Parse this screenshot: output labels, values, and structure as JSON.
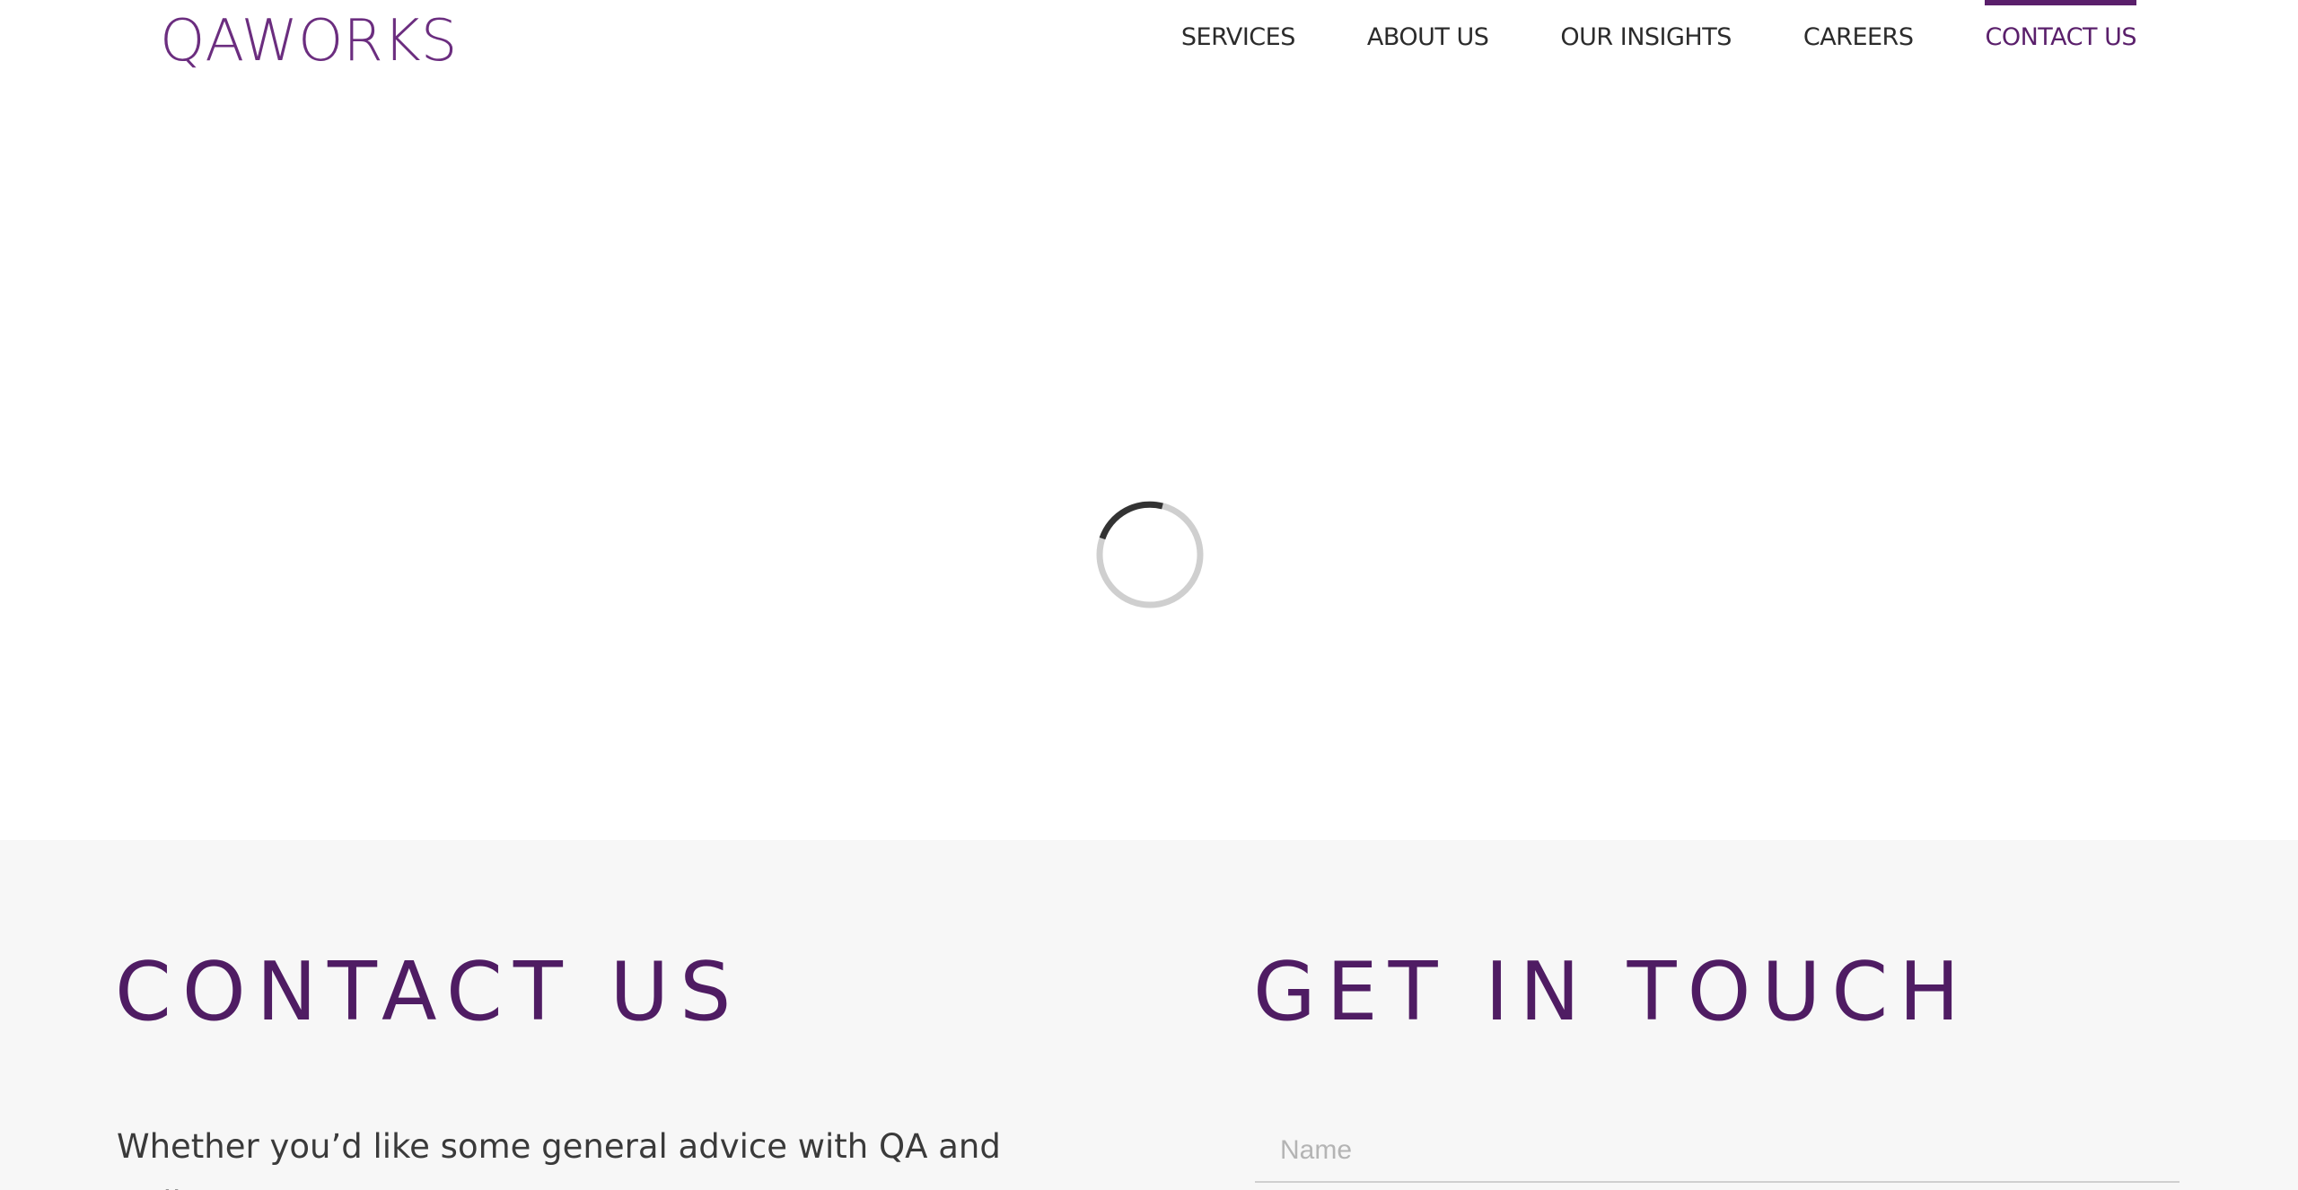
{
  "brand": {
    "logo_text": "QAWORKS",
    "accent_color": "#5a1f6b"
  },
  "nav": {
    "items": [
      {
        "label": "SERVICES"
      },
      {
        "label": "ABOUT US"
      },
      {
        "label": "OUR INSIGHTS"
      },
      {
        "label": "CAREERS"
      },
      {
        "label": "CONTACT US",
        "active": true
      }
    ]
  },
  "hero": {
    "loading_icon": "spinner-icon"
  },
  "contact": {
    "title": "CONTACT US",
    "intro": "Whether you’d like some general advice with QA and Delivery"
  },
  "get_in_touch": {
    "title": "GET IN TOUCH",
    "name_placeholder": "Name",
    "name_value": ""
  }
}
